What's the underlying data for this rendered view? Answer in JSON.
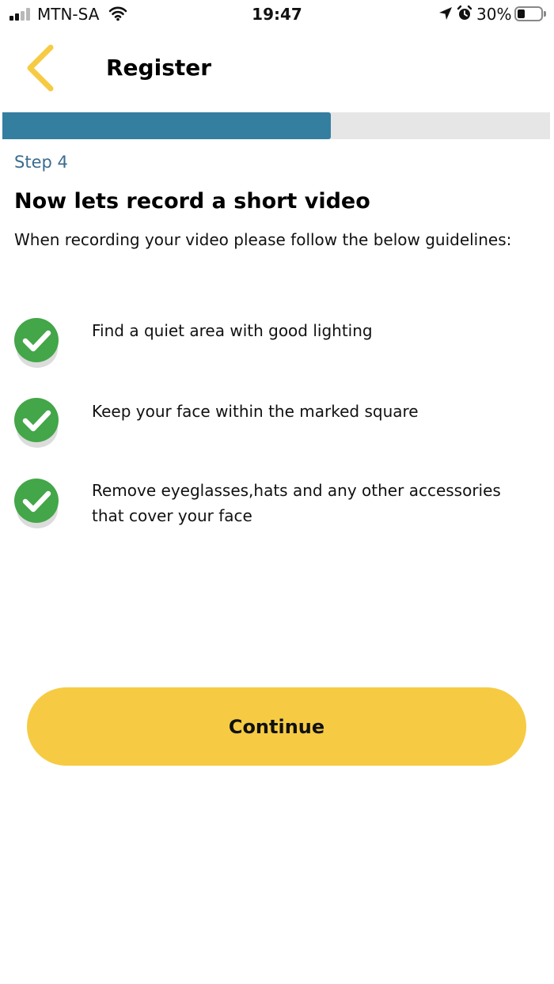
{
  "status_bar": {
    "carrier": "MTN-SA",
    "time": "19:47",
    "battery_percent": "30%",
    "battery_level": 0.3,
    "signal_bars_filled": 2,
    "signal_bars_total": 4,
    "icons": [
      "signal-icon",
      "wifi-icon",
      "location-arrow-icon",
      "alarm-clock-icon",
      "battery-icon"
    ]
  },
  "header": {
    "title": "Register",
    "back_icon": "chevron-left-icon"
  },
  "progress": {
    "fraction": 0.6
  },
  "step": {
    "label": "Step 4",
    "heading": "Now lets record a short video",
    "intro": "When recording your video please follow the below guidelines:"
  },
  "guidelines": [
    {
      "icon": "check-circle-icon",
      "text": "Find a quiet area with good lighting"
    },
    {
      "icon": "check-circle-icon",
      "text": "Keep your face within the marked square"
    },
    {
      "icon": "check-circle-icon",
      "text": "Remove eyeglasses,hats and any other accessories that cover your face"
    }
  ],
  "actions": {
    "continue_label": "Continue"
  },
  "colors": {
    "accent_yellow": "#f6cb43",
    "back_chevron": "#f6cb43",
    "progress_fill": "#347ea0",
    "progress_track": "#e6e6e6",
    "step_label": "#3b6d8f",
    "check_green": "#43a648"
  }
}
